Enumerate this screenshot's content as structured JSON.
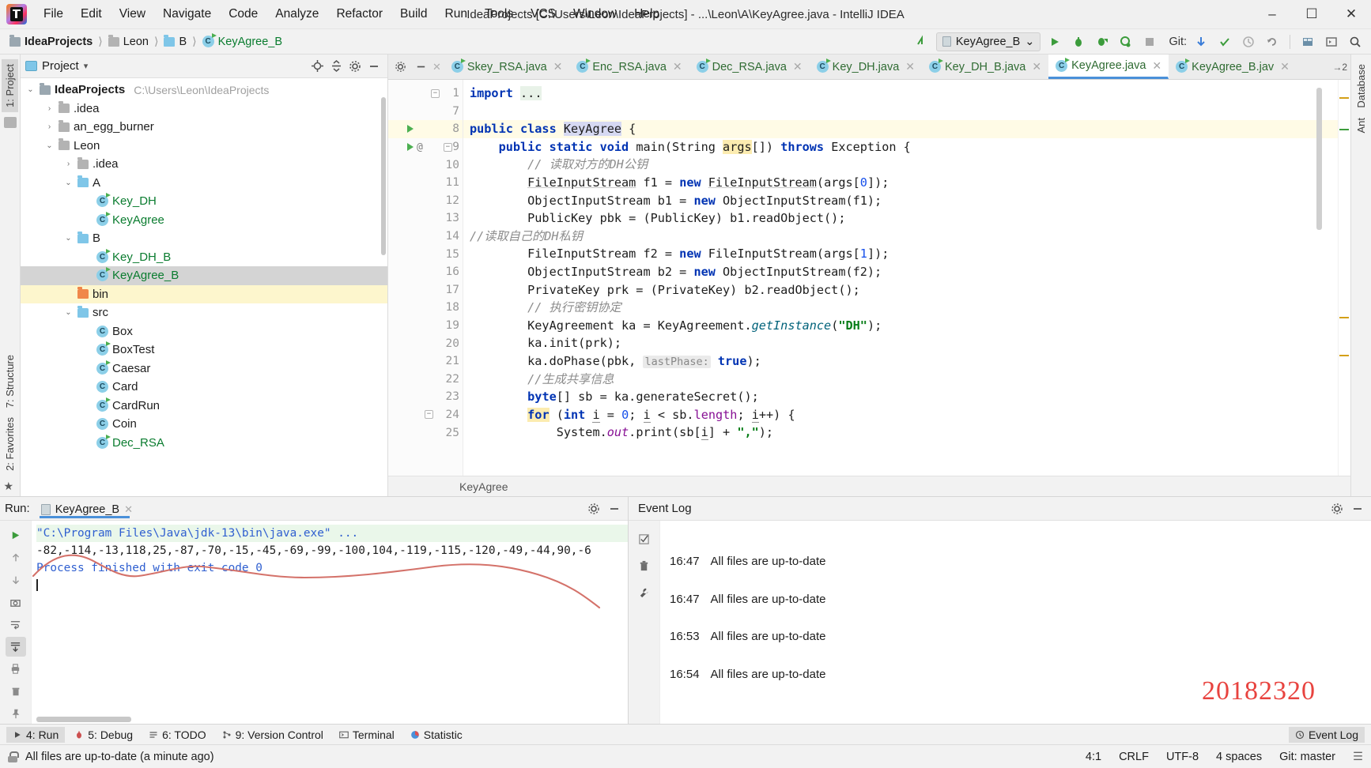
{
  "window": {
    "title": "IdeaProjects [C:\\Users\\Leon\\IdeaProjects] - ...\\Leon\\A\\KeyAgree.java - IntelliJ IDEA",
    "minimize": "–",
    "maximize": "☐",
    "close": "✕"
  },
  "menu": [
    "File",
    "Edit",
    "View",
    "Navigate",
    "Code",
    "Analyze",
    "Refactor",
    "Build",
    "Run",
    "Tools",
    "VCS",
    "Window",
    "Help"
  ],
  "breadcrumbs": [
    {
      "label": "IdeaProjects",
      "icon": "project-folder-icon",
      "style": "bold"
    },
    {
      "label": "Leon",
      "icon": "folder-icon",
      "style": "normal"
    },
    {
      "label": "B",
      "icon": "folder-blue-icon",
      "style": "normal"
    },
    {
      "label": "KeyAgree_B",
      "icon": "java-class-icon",
      "style": "green"
    }
  ],
  "toolbar": {
    "run_config": "KeyAgree_B",
    "run_config_caret": "⌄",
    "git_label": "Git:",
    "icons": [
      "build-icon",
      "run-icon",
      "debug-icon",
      "run-coverage-icon",
      "profile-icon",
      "stop-icon",
      "update-project-icon",
      "commit-icon",
      "history-icon",
      "rollback-icon",
      "database-icon",
      "terminal-icon",
      "search-everywhere-icon"
    ]
  },
  "left_rail": {
    "tabs": [
      "1: Project"
    ],
    "bottom_tabs": [
      "2: Favorites",
      "7: Structure"
    ]
  },
  "right_rail": {
    "tabs": [
      "Database",
      "Ant"
    ]
  },
  "project_panel": {
    "title": "Project",
    "dropdown_caret": "▾",
    "header_icons": [
      "locate-icon",
      "collapse-all-icon",
      "settings-icon",
      "hide-icon"
    ],
    "tree": [
      {
        "depth": 0,
        "arrow": "⌄",
        "icon": "project-folder-icon",
        "label": "IdeaProjects",
        "bold": true,
        "path": "C:\\Users\\Leon\\IdeaProjects",
        "state": "normal"
      },
      {
        "depth": 1,
        "arrow": "›",
        "icon": "folder-icon",
        "label": ".idea",
        "state": "normal"
      },
      {
        "depth": 1,
        "arrow": "›",
        "icon": "folder-icon",
        "label": "an_egg_burner",
        "state": "normal"
      },
      {
        "depth": 1,
        "arrow": "⌄",
        "icon": "folder-icon",
        "label": "Leon",
        "state": "normal"
      },
      {
        "depth": 2,
        "arrow": "›",
        "icon": "folder-icon",
        "label": ".idea",
        "state": "normal"
      },
      {
        "depth": 2,
        "arrow": "⌄",
        "icon": "folder-blue-icon",
        "label": "A",
        "state": "normal"
      },
      {
        "depth": 3,
        "arrow": "",
        "icon": "java-class-run-icon",
        "label": "Key_DH",
        "green": true,
        "state": "normal"
      },
      {
        "depth": 3,
        "arrow": "",
        "icon": "java-class-run-icon",
        "label": "KeyAgree",
        "green": true,
        "state": "normal"
      },
      {
        "depth": 2,
        "arrow": "⌄",
        "icon": "folder-blue-icon",
        "label": "B",
        "state": "normal"
      },
      {
        "depth": 3,
        "arrow": "",
        "icon": "java-class-run-icon",
        "label": "Key_DH_B",
        "green": true,
        "state": "normal"
      },
      {
        "depth": 3,
        "arrow": "",
        "icon": "java-class-run-icon",
        "label": "KeyAgree_B",
        "green": true,
        "state": "selected"
      },
      {
        "depth": 2,
        "arrow": "",
        "icon": "folder-orange-icon",
        "label": "bin",
        "state": "highlight"
      },
      {
        "depth": 2,
        "arrow": "⌄",
        "icon": "folder-blue-icon",
        "label": "src",
        "state": "normal"
      },
      {
        "depth": 3,
        "arrow": "",
        "icon": "java-class-icon",
        "label": "Box",
        "state": "normal"
      },
      {
        "depth": 3,
        "arrow": "",
        "icon": "java-class-run-icon",
        "label": "BoxTest",
        "state": "normal"
      },
      {
        "depth": 3,
        "arrow": "",
        "icon": "java-class-run-icon",
        "label": "Caesar",
        "state": "normal"
      },
      {
        "depth": 3,
        "arrow": "",
        "icon": "java-class-icon",
        "label": "Card",
        "state": "normal"
      },
      {
        "depth": 3,
        "arrow": "",
        "icon": "java-class-run-icon",
        "label": "CardRun",
        "state": "normal"
      },
      {
        "depth": 3,
        "arrow": "",
        "icon": "java-class-icon",
        "label": "Coin",
        "state": "normal"
      },
      {
        "depth": 3,
        "arrow": "",
        "icon": "java-class-run-icon",
        "label": "Dec_RSA",
        "green": true,
        "state": "normal"
      }
    ]
  },
  "editor": {
    "tabs": [
      {
        "label": "Skey_RSA.java",
        "active": false
      },
      {
        "label": "Enc_RSA.java",
        "active": false
      },
      {
        "label": "Dec_RSA.java",
        "active": false
      },
      {
        "label": "Key_DH.java",
        "active": false
      },
      {
        "label": "Key_DH_B.java",
        "active": false
      },
      {
        "label": "KeyAgree.java",
        "active": true
      },
      {
        "label": "KeyAgree_B.jav",
        "active": false
      }
    ],
    "tabs_overflow": "→2",
    "breadcrumb": "KeyAgree",
    "lines": [
      {
        "n": "1",
        "marks": [
          "fold-minus"
        ]
      },
      {
        "n": "7",
        "marks": []
      },
      {
        "n": "8",
        "marks": [
          "run-gutter-icon"
        ],
        "highlight": true
      },
      {
        "n": "9",
        "marks": [
          "run-gutter-icon",
          "override-at-icon",
          "fold-collapse"
        ]
      },
      {
        "n": "10",
        "marks": []
      },
      {
        "n": "11",
        "marks": []
      },
      {
        "n": "12",
        "marks": []
      },
      {
        "n": "13",
        "marks": []
      },
      {
        "n": "14",
        "marks": []
      },
      {
        "n": "15",
        "marks": []
      },
      {
        "n": "16",
        "marks": []
      },
      {
        "n": "17",
        "marks": []
      },
      {
        "n": "18",
        "marks": []
      },
      {
        "n": "19",
        "marks": []
      },
      {
        "n": "20",
        "marks": []
      },
      {
        "n": "21",
        "marks": []
      },
      {
        "n": "22",
        "marks": []
      },
      {
        "n": "23",
        "marks": []
      },
      {
        "n": "24",
        "marks": [
          "fold-collapse"
        ]
      },
      {
        "n": "25",
        "marks": []
      }
    ],
    "code_text": [
      "import ...",
      "",
      "public class KeyAgree {",
      "    public static void main(String args[]) throws Exception {",
      "        // 读取对方的DH公钥",
      "        FileInputStream f1 = new FileInputStream(args[0]);",
      "        ObjectInputStream b1 = new ObjectInputStream(f1);",
      "        PublicKey pbk = (PublicKey) b1.readObject();",
      "//读取自己的DH私钥",
      "        FileInputStream f2 = new FileInputStream(args[1]);",
      "        ObjectInputStream b2 = new ObjectInputStream(f2);",
      "        PrivateKey prk = (PrivateKey) b2.readObject();",
      "        // 执行密钥协定",
      "        KeyAgreement ka = KeyAgreement.getInstance(\"DH\");",
      "        ka.init(prk);",
      "        ka.doPhase(pbk,  lastPhase: true);",
      "        //生成共享信息",
      "        byte[] sb = ka.generateSecret();",
      "        for (int i = 0; i < sb.length; i++) {",
      "            System.out.print(sb[i] + \",\");"
    ]
  },
  "run_panel": {
    "label": "Run:",
    "tab": "KeyAgree_B",
    "tab_close": "✕",
    "settings_icon": "gear-icon",
    "minimize_icon": "minimize-icon",
    "rail_icons": [
      "rerun-icon",
      "up-stack-icon",
      "down-stack-icon",
      "camera-icon",
      "wrap-icon",
      "scroll-end-icon",
      "print-icon",
      "trash-icon",
      "pin-icon",
      "exit-icon"
    ],
    "console": {
      "command": "\"C:\\Program Files\\Java\\jdk-13\\bin\\java.exe\" ...",
      "output": "-82,-114,-13,118,25,-87,-70,-15,-45,-69,-99,-100,104,-119,-115,-120,-49,-44,90,-6",
      "exit": "Process finished with exit code 0"
    }
  },
  "event_log": {
    "title": "Event Log",
    "settings_icon": "gear-icon",
    "minimize_icon": "minimize-icon",
    "rail_icons": [
      "mark-read-icon",
      "trash-icon",
      "wrench-icon"
    ],
    "entries": [
      {
        "time": "16:47",
        "message": "All files are up-to-date"
      },
      {
        "time": "16:47",
        "message": "All files are up-to-date"
      },
      {
        "time": "16:53",
        "message": "All files are up-to-date"
      },
      {
        "time": "16:54",
        "message": "All files are up-to-date"
      }
    ],
    "watermark": "20182320"
  },
  "toolwindow_bar": {
    "items": [
      {
        "label": "4: Run",
        "icon": "run-icon",
        "active": true
      },
      {
        "label": "5: Debug",
        "icon": "debug-icon",
        "active": false
      },
      {
        "label": "6: TODO",
        "icon": "todo-icon",
        "active": false
      },
      {
        "label": "9: Version Control",
        "icon": "vcs-icon",
        "active": false
      },
      {
        "label": "Terminal",
        "icon": "terminal-icon",
        "active": false
      },
      {
        "label": "Statistic",
        "icon": "statistic-icon",
        "active": false
      }
    ],
    "right": {
      "label": "Event Log",
      "icon": "event-log-icon"
    }
  },
  "status_bar": {
    "message": "All files are up-to-date (a minute ago)",
    "caret": "4:1",
    "line_sep": "CRLF",
    "encoding": "UTF-8",
    "indent": "4 spaces",
    "branch": "Git: master",
    "lock_icon": "lock-icon"
  },
  "colors": {
    "accent_blue": "#4a90d9",
    "green_text": "#0a7c2f",
    "keyword_blue": "#0033b3",
    "string_green": "#067d17",
    "watermark_red": "#e8433f",
    "selection_gray": "#d4d4d4",
    "highlight_yellow": "#fdf6cd"
  }
}
